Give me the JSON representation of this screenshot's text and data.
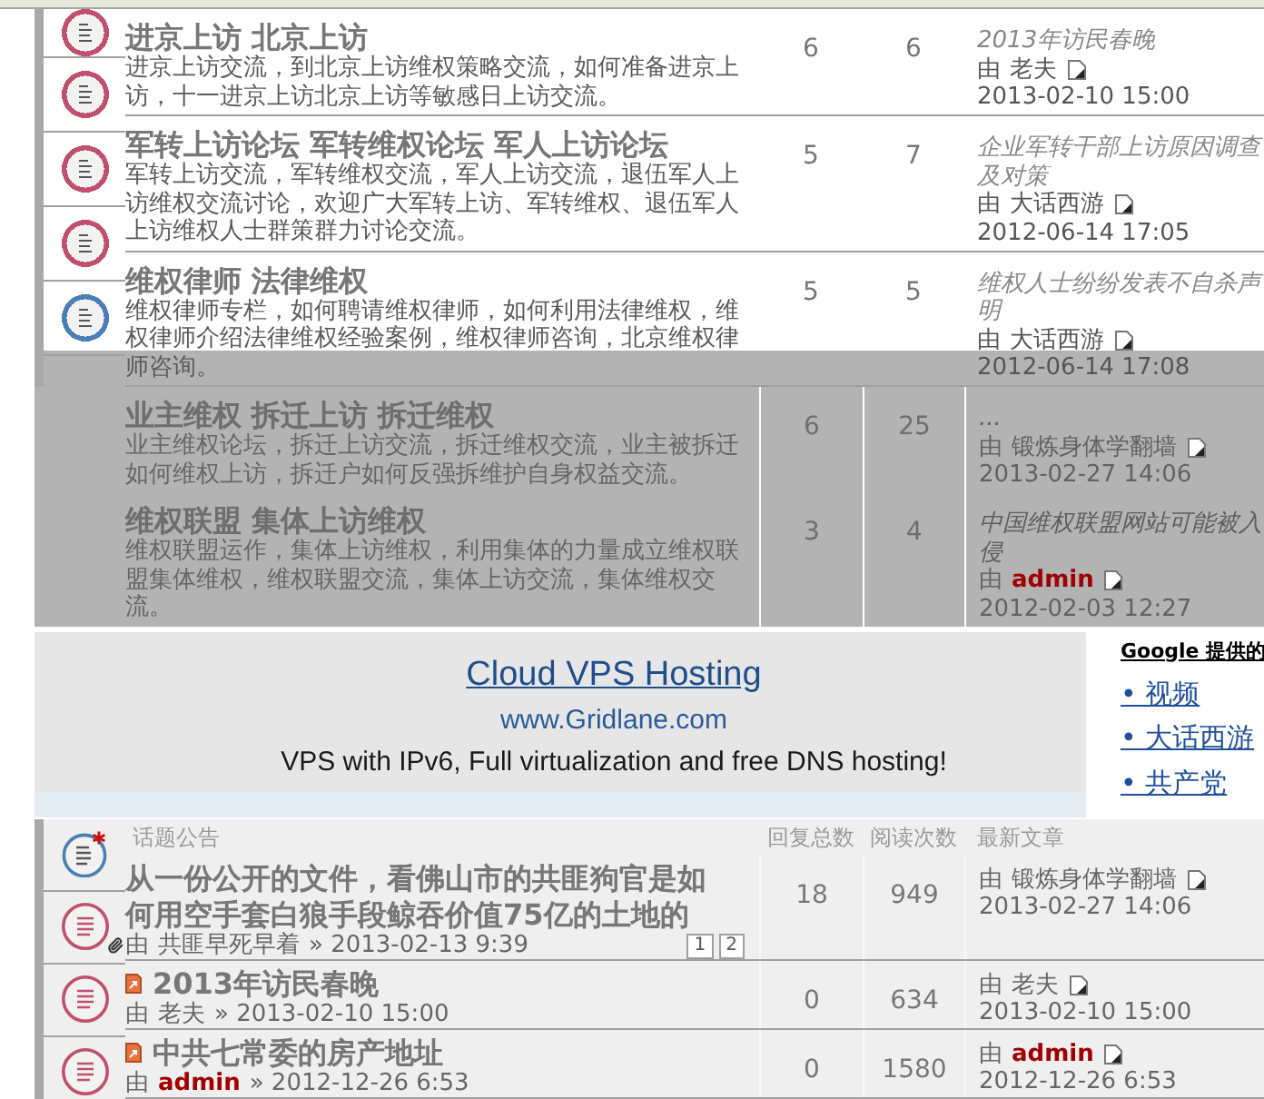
{
  "forums": [
    {
      "title": "进京上访 北京上访",
      "description": "进京上访交流，到北京上访维权策略交流，如何准备进京上访，十一进京上访北京上访等敏感日上访交流。",
      "column_2": "6",
      "column_3": "6",
      "last_post": {
        "title": "2013年访民春晚",
        "by": "由",
        "author": {
          "name": "老夫"
        },
        "date": "2013-02-10 15:00"
      },
      "dimmed": false
    },
    {
      "title": "军转上访论坛 军转维权论坛 军人上访论坛",
      "description": "军转上访交流，军转维权交流，军人上访交流，退伍军人上访维权交流讨论，欢迎广大军转上访、军转维权、退伍军人上访维权人士群策群力讨论交流。",
      "column_2": "5",
      "column_3": "7",
      "last_post": {
        "title": "企业军转干部上访原因调查及对策",
        "by": "由",
        "author": {
          "name": "大话西游"
        },
        "date": "2012-06-14 17:05"
      },
      "dimmed": false
    },
    {
      "title": "维权律师 法律维权",
      "description": "维权律师专栏，如何聘请维权律师，如何利用法律维权，维权律师介绍法律维权经验案例，维权律师咨询，北京维权律师咨询。",
      "column_2": "5",
      "column_3": "5",
      "last_post": {
        "title": "维权人士纷纷发表不自杀声明",
        "by": "由",
        "author": {
          "name": "大话西游"
        },
        "date": "2012-06-14 17:08"
      },
      "dimmed": false
    },
    {
      "title": "业主维权 拆迁上访 拆迁维权",
      "description": "业主维权论坛，拆迁上访交流，拆迁维权交流，业主被拆迁如何维权上访，拆迁户如何反强拆维护自身权益交流。",
      "column_2": "6",
      "column_3": "25",
      "last_post": {
        "title": "...",
        "by": "由",
        "author": {
          "name": "锻炼身体学翻墙"
        },
        "date": "2013-02-27 14:06"
      },
      "dimmed": true
    },
    {
      "title": "维权联盟 集体上访维权",
      "description": "维权联盟运作，集体上访维权，利用集体的力量成立维权联盟集体维权，维权联盟交流，集体上访交流，集体维权交流。",
      "column_2": "3",
      "column_3": "4",
      "last_post": {
        "title": "中国维权联盟网站可能被入侵",
        "by": "由",
        "author": {
          "name": "admin",
          "color": "#a00000"
        },
        "date": "2012-02-03 12:27"
      },
      "dimmed": true
    }
  ],
  "forum_icons": [
    {
      "color": "#c0506e"
    },
    {
      "color": "#c0506e"
    },
    {
      "color": "#c0506e"
    },
    {
      "color": "#c0506e"
    },
    {
      "color": "#4a80b4"
    }
  ],
  "ad": {
    "title": "Cloud VPS Hosting",
    "url": "www.Gridlane.com",
    "text": "VPS with IPv6, Full virtualization and free DNS hosting!"
  },
  "google_links": {
    "heading": "Google 提供的",
    "links": [
      "• 视频",
      "• 大话西游",
      "• 共产党"
    ]
  },
  "topic_list": {
    "columns": [
      "话题公告",
      "回复总数",
      "阅读次数",
      "最新文章"
    ],
    "icons": [
      {
        "kind": "announcement"
      },
      {
        "kind": "topic"
      },
      {
        "kind": "topic"
      },
      {
        "kind": "topic"
      }
    ],
    "rows": [
      {
        "title": "从一份公开的文件，看佛山市的共匪狗官是如何用空手套白狼手段鲸吞价值75亿的土地的",
        "new_post": false,
        "attachment": true,
        "by": "由",
        "author": {
          "name": "共匪早死早着"
        },
        "posted": "» 2013-02-13 9:39",
        "pages": [
          "1",
          "2"
        ],
        "replies": "18",
        "views": "949",
        "last_post": {
          "by": "由",
          "author": {
            "name": "锻炼身体学翻墙"
          },
          "date": "2013-02-27 14:06"
        }
      },
      {
        "title": "2013年访民春晚",
        "new_post": true,
        "attachment": false,
        "by": "由",
        "author": {
          "name": "老夫"
        },
        "posted": "» 2013-02-10 15:00",
        "replies": "0",
        "views": "634",
        "last_post": {
          "by": "由",
          "author": {
            "name": "老夫"
          },
          "date": "2013-02-10 15:00"
        }
      },
      {
        "title": "中共七常委的房产地址",
        "new_post": true,
        "attachment": false,
        "by": "由",
        "author": {
          "name": "admin",
          "color": "#a00000"
        },
        "posted": "» 2012-12-26 6:53",
        "replies": "0",
        "views": "1580",
        "last_post": {
          "by": "由",
          "author": {
            "name": "admin",
            "color": "#a00000"
          },
          "date": "2012-12-26 6:53"
        }
      }
    ]
  }
}
